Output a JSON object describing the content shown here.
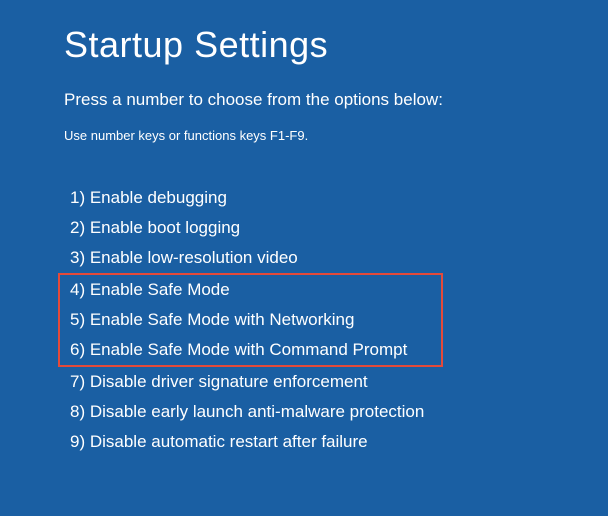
{
  "title": "Startup Settings",
  "subtitle": "Press a number to choose from the options below:",
  "hint": "Use number keys or functions keys F1-F9.",
  "options": {
    "o1": "1) Enable debugging",
    "o2": "2) Enable boot logging",
    "o3": "3) Enable low-resolution video",
    "o4": "4) Enable Safe Mode",
    "o5": "5) Enable Safe Mode with Networking",
    "o6": "6) Enable Safe Mode with Command Prompt",
    "o7": "7) Disable driver signature enforcement",
    "o8": "8) Disable early launch anti-malware protection",
    "o9": "9) Disable automatic restart after failure"
  },
  "colors": {
    "background": "#1a5fa3",
    "text": "#ffffff",
    "highlight_border": "#e44a3a"
  }
}
